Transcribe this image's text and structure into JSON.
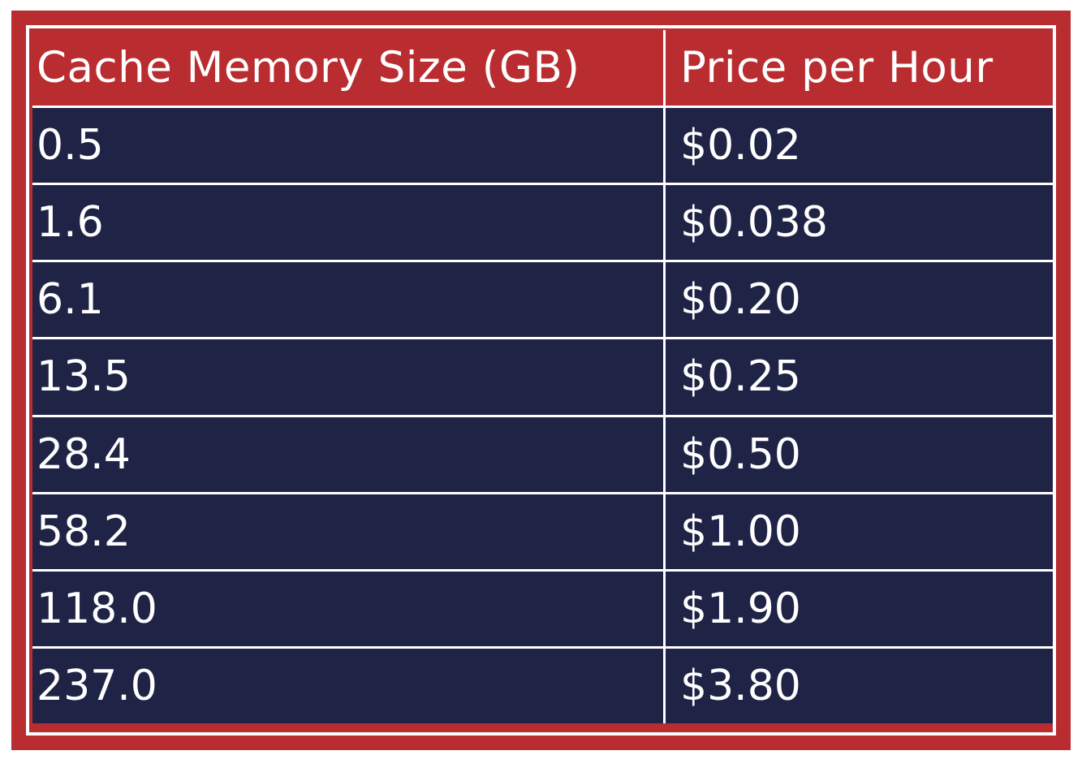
{
  "chart_data": {
    "type": "table",
    "columns": [
      "Cache Memory Size (GB)",
      "Price per Hour"
    ],
    "rows": [
      [
        "0.5",
        "$0.02"
      ],
      [
        "1.6",
        "$0.038"
      ],
      [
        "6.1",
        "$0.20"
      ],
      [
        "13.5",
        "$0.25"
      ],
      [
        "28.4",
        "$0.50"
      ],
      [
        "58.2",
        "$1.00"
      ],
      [
        "118.0",
        "$1.90"
      ],
      [
        "237.0",
        "$3.80"
      ]
    ]
  },
  "colors": {
    "frame_red": "#b92c30",
    "body_navy": "#1f2447",
    "text_white": "#ffffff"
  }
}
